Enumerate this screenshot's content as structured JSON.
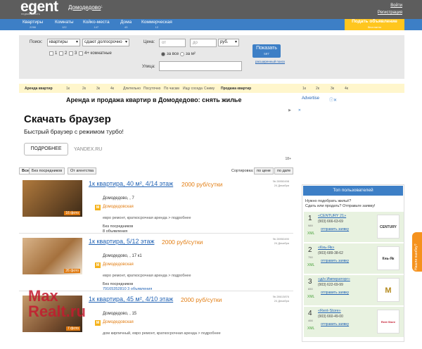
{
  "header": {
    "logo": "egent",
    "logo_sub": "недвижимость",
    "city": "Домодедово",
    "city_arrow": "↓",
    "login": "Войти",
    "register": "Регистрация"
  },
  "nav": [
    {
      "label": "Квартиры",
      "count": "2266"
    },
    {
      "label": "Комнаты",
      "count": "122"
    },
    {
      "label": "Койко-места",
      "count": "147"
    },
    {
      "label": "Дома",
      "count": "43"
    },
    {
      "label": "Коммерческая",
      "count": "12"
    }
  ],
  "post_button": {
    "label": "Подать объявление",
    "sub": "бесплатно"
  },
  "search": {
    "search_label": "Поиск:",
    "type": "квартиры",
    "term": "сдают долгосрочно",
    "rooms": [
      "1",
      "2",
      "3",
      "4+ комнатные"
    ],
    "price_label": "Цена:",
    "from": "от",
    "to": "до",
    "currency": "руб.",
    "per_all": "за все",
    "per_m2": "за м²",
    "street_label": "Улица:",
    "button": "Показать",
    "button_sub": "597",
    "advanced": "расширенный поиск"
  },
  "strip": {
    "left_bold": "Аренда квартир",
    "left": [
      "1к",
      "2к",
      "3к",
      "4к",
      "Длительно",
      "Посуточно",
      "По часам",
      "Ищу соседа",
      "Сниму"
    ],
    "right_bold": "Продажа квартир",
    "right": [
      "1к",
      "2к",
      "3к",
      "4к"
    ]
  },
  "page_title": "Аренда и продажа квартир в Домодедово: снять жилье",
  "ad": {
    "title": "Скачать браузер",
    "text": "Быстрый браузер с режимом турбо!",
    "button": "ПОДРОБНЕЕ",
    "brand": "YANDEX.RU",
    "age": "18+",
    "tag": "▶",
    "close": "✕"
  },
  "filters": {
    "all": "Все",
    "no_agent": "Без посредников",
    "agency": "От агентства",
    "sort_label": "Сортировка:",
    "by_price": "по цене",
    "by_date": "по дате"
  },
  "listings": [
    {
      "title": "1к квартира, 40 м², 4/14 этаж",
      "price": "2000 руб/сутки",
      "id": "№ 28950498",
      "date": "24 Декабря",
      "addr": "Домодедово, , 7",
      "metro": "Домодедовская",
      "desc": "евро ремонт, краткосрочная аренда > подробнее",
      "owner": "Без посредников",
      "owner2": "8 объявления",
      "photos": "16 фото"
    },
    {
      "title": "1к квартира, 5/12 этаж",
      "price": "2000 руб/сутки",
      "id": "№ 28950490",
      "date": "24 Декабря",
      "addr": "Домодедово, , 17 к1",
      "metro": "Домодедовская",
      "desc": "евро ремонт, краткосрочная аренда > подробнее",
      "owner": "Без посредников",
      "owner2": "79165352810 3 объявления",
      "photos": "26 фото"
    },
    {
      "title": "1к квартира, 45 м², 4/10 этаж",
      "price": "2000 руб/сутки",
      "id": "№ 28613876",
      "date": "24 Декабря",
      "addr": "Домодедово, , 15",
      "metro": "Домодедовская",
      "desc": "дом кирпичный, евро ремонт, краткосрочная аренда > подробнее",
      "owner": "",
      "owner2": "",
      "photos": "7 фото"
    }
  ],
  "right": {
    "ad_label": "Advertise",
    "ad_x": "ⓘ✕",
    "panel_title": "Топ пользователей",
    "question": "Нужно подобрать жильё?",
    "question2": "Сдать или продать? Отправьте заявку!",
    "users": [
      {
        "num": "1",
        "small": "989",
        "name": "«CENTURY 21»",
        "tel": "(903) 666-63-69",
        "link": "отправить заявку",
        "logo": "CENTURY 21"
      },
      {
        "num": "2",
        "small": "750",
        "name": "«Кнь-Як»",
        "tel": "(903) 689-38-62",
        "link": "отправить заявку",
        "logo": "Кнь-Як"
      },
      {
        "num": "3",
        "small": "650",
        "name": "«д/н Императорг»",
        "tel": "(903) 622-69-99",
        "link": "отправить заявку",
        "logo": "M"
      },
      {
        "num": "4",
        "small": "466",
        "name": "«Rent-Store»",
        "tel": "(903) 660-49-00",
        "link": "отправить заявку",
        "logo": "Rent Store"
      }
    ],
    "xml": "XML"
  },
  "feedback": "Нашли ошибку?",
  "watermark": {
    "line1": "Max",
    "line2": "Realt.ru"
  }
}
